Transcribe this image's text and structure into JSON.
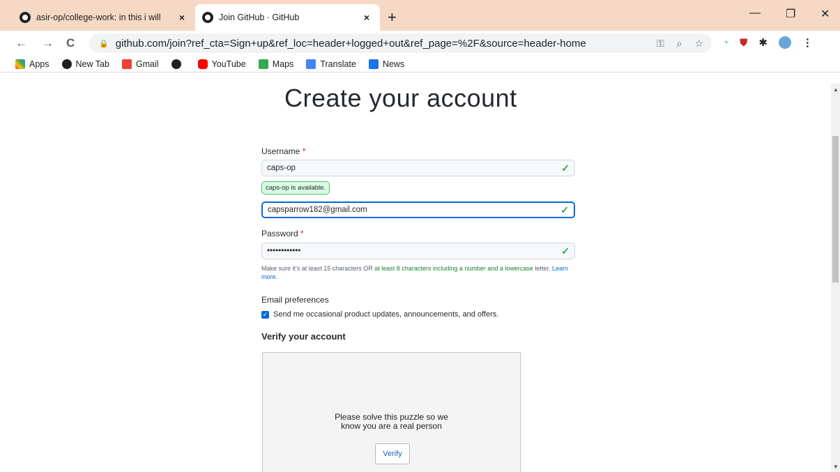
{
  "tabs": [
    {
      "title": "asir-op/college-work: in this i will",
      "close": "×"
    },
    {
      "title": "Join GitHub · GitHub",
      "close": "×"
    }
  ],
  "new_tab": "+",
  "window_controls": {
    "minimize": "—",
    "maximize": "❐",
    "close": "✕"
  },
  "toolbar": {
    "back": "←",
    "forward": "→",
    "reload": "C"
  },
  "address": {
    "url": "github.com/join?ref_cta=Sign+up&ref_loc=header+logged+out&ref_page=%2F&source=header-home"
  },
  "bookmarks": [
    {
      "label": "Apps",
      "icon": "apps-grid-icon",
      "color": "#ea4335"
    },
    {
      "label": "New Tab",
      "icon": "globe-icon",
      "color": "#202124"
    },
    {
      "label": "Gmail",
      "icon": "gmail-icon",
      "color": "#ea4335"
    },
    {
      "label": "",
      "icon": "globe-icon",
      "color": "#202124"
    },
    {
      "label": "YouTube",
      "icon": "youtube-icon",
      "color": "#ff0000"
    },
    {
      "label": "Maps",
      "icon": "maps-icon",
      "color": "#34a853"
    },
    {
      "label": "Translate",
      "icon": "translate-icon",
      "color": "#4285f4"
    },
    {
      "label": "News",
      "icon": "news-icon",
      "color": "#1a73e8"
    }
  ],
  "form": {
    "heading": "Create your account",
    "username_label": "Username",
    "required_mark": "*",
    "username_value": "caps-op",
    "username_tooltip": "caps-op is available.",
    "email_value": "capsparrow182@gmail.com",
    "password_label": "Password",
    "password_value": "••••••••••••",
    "hint_prefix": "Make sure it's at least 15 characters OR ",
    "hint_green": "at least 8 characters including a number and a lowercase",
    "hint_mid": " letter. ",
    "hint_link": "Learn more.",
    "email_prefs_label": "Email preferences",
    "email_prefs_checkbox": "Send me occasional product updates, announcements, and offers.",
    "verify_title": "Verify your account",
    "puzzle_line1": "Please solve this puzzle so we",
    "puzzle_line2": "know you are a real person",
    "verify_button": "Verify"
  },
  "colors": {
    "tabstrip": "#f6d9c4",
    "accent": "#0969da",
    "success": "#2da44e"
  }
}
